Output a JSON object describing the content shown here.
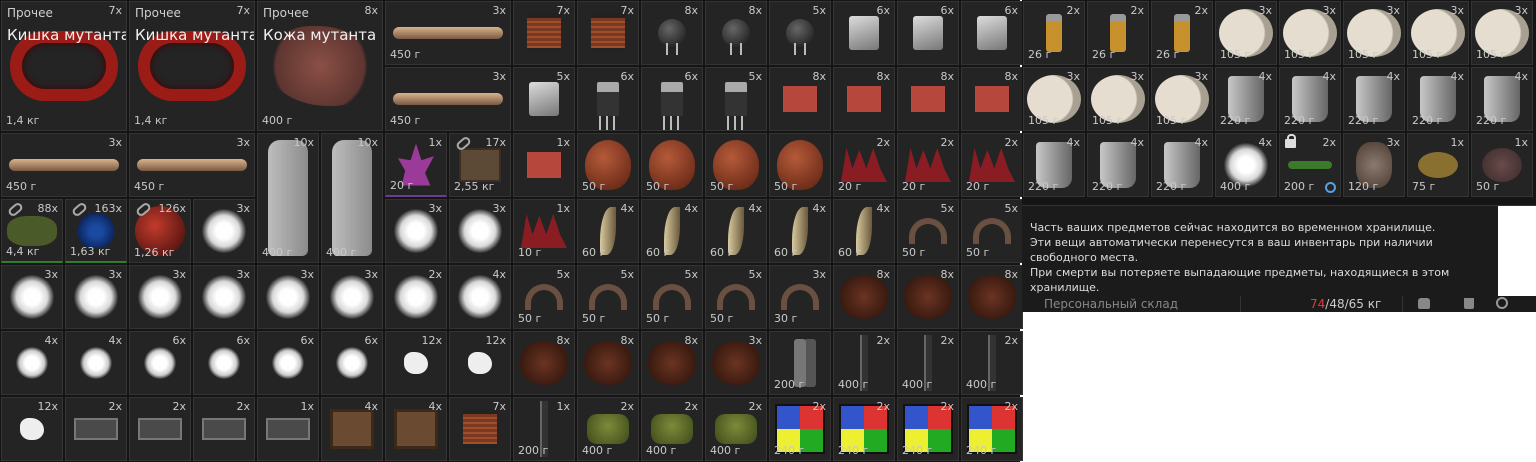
{
  "inventory": {
    "items": [
      {
        "cat": "Прочее",
        "name": "Кишка мутанта",
        "qty": "7x",
        "wt": "1,4 кг",
        "icon": "guts-icon"
      },
      {
        "cat": "Прочее",
        "name": "Кишка мутанта",
        "qty": "7x",
        "wt": "1,4 кг",
        "icon": "guts-icon"
      },
      {
        "cat": "Прочее",
        "name": "Кожа мутанта",
        "qty": "8x",
        "wt": "400 г",
        "icon": "skin-icon"
      },
      {
        "qty": "3x",
        "wt": "450 г",
        "icon": "bone-icon"
      },
      {
        "qty": "7x",
        "wt": "",
        "icon": "coil-icon"
      },
      {
        "qty": "7x",
        "wt": "",
        "icon": "coil-icon"
      },
      {
        "qty": "8x",
        "wt": "",
        "icon": "capacitor-icon"
      },
      {
        "qty": "8x",
        "wt": "",
        "icon": "capacitor-icon"
      },
      {
        "qty": "5x",
        "wt": "",
        "icon": "capacitor-icon"
      },
      {
        "qty": "6x",
        "wt": "",
        "icon": "crystal-icon"
      },
      {
        "qty": "6x",
        "wt": "",
        "icon": "crystal-icon"
      },
      {
        "qty": "6x",
        "wt": "",
        "icon": "crystal-icon"
      },
      {
        "qty": "3x",
        "wt": "450 г",
        "icon": "bone-icon"
      },
      {
        "qty": "5x",
        "wt": "",
        "icon": "crystal-icon"
      },
      {
        "qty": "6x",
        "wt": "",
        "icon": "transistor-icon"
      },
      {
        "qty": "6x",
        "wt": "",
        "icon": "transistor-icon"
      },
      {
        "qty": "5x",
        "wt": "",
        "icon": "transistor-icon"
      },
      {
        "qty": "8x",
        "wt": "",
        "icon": "circuit-board-icon"
      },
      {
        "qty": "8x",
        "wt": "",
        "icon": "circuit-board-icon"
      },
      {
        "qty": "8x",
        "wt": "",
        "icon": "circuit-board-icon"
      },
      {
        "qty": "8x",
        "wt": "",
        "icon": "circuit-board-icon"
      },
      {
        "qty": "3x",
        "wt": "450 г",
        "icon": "bone-icon"
      },
      {
        "qty": "3x",
        "wt": "450 г",
        "icon": "bone-icon"
      },
      {
        "qty": "10x",
        "wt": "400 г",
        "icon": "bottle-icon"
      },
      {
        "qty": "10x",
        "wt": "400 г",
        "icon": "bottle-icon"
      },
      {
        "qty": "1x",
        "wt": "20 г",
        "icon": "amethyst-icon"
      },
      {
        "qty": "17x",
        "wt": "2,55 кг",
        "icon": "box-icon",
        "link": true
      },
      {
        "qty": "1x",
        "wt": "",
        "icon": "circuit-board-icon"
      },
      {
        "qty": "",
        "wt": "50 г",
        "icon": "heart-icon"
      },
      {
        "qty": "",
        "wt": "50 г",
        "icon": "heart-icon"
      },
      {
        "qty": "",
        "wt": "50 г",
        "icon": "heart-icon"
      },
      {
        "qty": "",
        "wt": "50 г",
        "icon": "heart-icon"
      },
      {
        "qty": "2x",
        "wt": "20 г",
        "icon": "spikes-icon"
      },
      {
        "qty": "2x",
        "wt": "20 г",
        "icon": "spikes-icon"
      },
      {
        "qty": "2x",
        "wt": "20 г",
        "icon": "spikes-icon"
      },
      {
        "qty": "88x",
        "wt": "4,4 кг",
        "icon": "moss-icon",
        "link": true
      },
      {
        "qty": "163x",
        "wt": "1,63 кг",
        "icon": "blue-berries-icon",
        "link": true
      },
      {
        "qty": "126x",
        "wt": "1,26 кг",
        "icon": "red-orb-icon",
        "link": true
      },
      {
        "qty": "3x",
        "wt": "",
        "icon": "fluff-icon"
      },
      {
        "qty": "3x",
        "wt": "",
        "icon": "fluff-icon"
      },
      {
        "qty": "3x",
        "wt": "",
        "icon": "fluff-icon"
      },
      {
        "qty": "1x",
        "wt": "10 г",
        "icon": "spikes-icon"
      },
      {
        "qty": "4x",
        "wt": "60 г",
        "icon": "claw-icon"
      },
      {
        "qty": "4x",
        "wt": "60 г",
        "icon": "claw-icon"
      },
      {
        "qty": "4x",
        "wt": "60 г",
        "icon": "claw-icon"
      },
      {
        "qty": "4x",
        "wt": "60 г",
        "icon": "claw-icon"
      },
      {
        "qty": "4x",
        "wt": "60 г",
        "icon": "claw-icon"
      },
      {
        "qty": "5x",
        "wt": "50 г",
        "icon": "hoof-icon"
      },
      {
        "qty": "5x",
        "wt": "50 г",
        "icon": "hoof-icon"
      },
      {
        "qty": "3x",
        "wt": "",
        "icon": "fluff-icon"
      },
      {
        "qty": "3x",
        "wt": "",
        "icon": "fluff-icon"
      },
      {
        "qty": "3x",
        "wt": "",
        "icon": "fluff-icon"
      },
      {
        "qty": "3x",
        "wt": "",
        "icon": "fluff-icon"
      },
      {
        "qty": "3x",
        "wt": "",
        "icon": "fluff-icon"
      },
      {
        "qty": "3x",
        "wt": "",
        "icon": "fluff-icon"
      },
      {
        "qty": "2x",
        "wt": "",
        "icon": "fluff-icon"
      },
      {
        "qty": "4x",
        "wt": "",
        "icon": "fluff-icon"
      },
      {
        "qty": "5x",
        "wt": "50 г",
        "icon": "hoof-icon"
      },
      {
        "qty": "5x",
        "wt": "50 г",
        "icon": "hoof-icon"
      },
      {
        "qty": "5x",
        "wt": "50 г",
        "icon": "hoof-icon"
      },
      {
        "qty": "5x",
        "wt": "50 г",
        "icon": "hoof-icon"
      },
      {
        "qty": "3x",
        "wt": "30 г",
        "icon": "hoof-icon"
      },
      {
        "qty": "8x",
        "wt": "",
        "icon": "fur-icon"
      },
      {
        "qty": "8x",
        "wt": "",
        "icon": "fur-icon"
      },
      {
        "qty": "8x",
        "wt": "",
        "icon": "fur-icon"
      },
      {
        "qty": "4x",
        "wt": "",
        "icon": "fluff-small-icon"
      },
      {
        "qty": "4x",
        "wt": "",
        "icon": "fluff-small-icon"
      },
      {
        "qty": "6x",
        "wt": "",
        "icon": "fluff-small-icon"
      },
      {
        "qty": "6x",
        "wt": "",
        "icon": "fluff-small-icon"
      },
      {
        "qty": "6x",
        "wt": "",
        "icon": "fluff-small-icon"
      },
      {
        "qty": "6x",
        "wt": "",
        "icon": "fluff-small-icon"
      },
      {
        "qty": "12x",
        "wt": "",
        "icon": "rock-icon"
      },
      {
        "qty": "12x",
        "wt": "",
        "icon": "rock-icon"
      },
      {
        "qty": "8x",
        "wt": "",
        "icon": "fur-icon"
      },
      {
        "qty": "8x",
        "wt": "",
        "icon": "fur-icon"
      },
      {
        "qty": "8x",
        "wt": "",
        "icon": "fur-icon"
      },
      {
        "qty": "3x",
        "wt": "",
        "icon": "fur-icon"
      },
      {
        "qty": "",
        "wt": "200 г",
        "icon": "pliers-icon"
      },
      {
        "qty": "2x",
        "wt": "400 г",
        "icon": "knife-icon"
      },
      {
        "qty": "2x",
        "wt": "400 г",
        "icon": "knife-icon"
      },
      {
        "qty": "2x",
        "wt": "400 г",
        "icon": "knife-icon"
      },
      {
        "qty": "12x",
        "wt": "",
        "icon": "rock-icon"
      },
      {
        "qty": "2x",
        "wt": "",
        "icon": "solenoid-icon"
      },
      {
        "qty": "2x",
        "wt": "",
        "icon": "solenoid-icon"
      },
      {
        "qty": "2x",
        "wt": "",
        "icon": "solenoid-icon"
      },
      {
        "qty": "1x",
        "wt": "",
        "icon": "solenoid-icon"
      },
      {
        "qty": "4x",
        "wt": "",
        "icon": "transformer-icon"
      },
      {
        "qty": "4x",
        "wt": "",
        "icon": "transformer-icon"
      },
      {
        "qty": "7x",
        "wt": "",
        "icon": "coil-icon"
      },
      {
        "qty": "1x",
        "wt": "200 г",
        "icon": "knife-icon"
      },
      {
        "qty": "2x",
        "wt": "400 г",
        "icon": "mine-icon"
      },
      {
        "qty": "2x",
        "wt": "400 г",
        "icon": "mine-icon"
      },
      {
        "qty": "2x",
        "wt": "400 г",
        "icon": "mine-icon"
      },
      {
        "qty": "2x",
        "wt": "240 г",
        "icon": "rubik-cube-icon"
      },
      {
        "qty": "2x",
        "wt": "240 г",
        "icon": "rubik-cube-icon"
      },
      {
        "qty": "2x",
        "wt": "240 г",
        "icon": "rubik-cube-icon"
      },
      {
        "qty": "2x",
        "wt": "240 г",
        "icon": "rubik-cube-icon"
      }
    ]
  },
  "storage": {
    "items": [
      {
        "qty": "2x",
        "wt": "26 г",
        "icon": "lighter-icon"
      },
      {
        "qty": "2x",
        "wt": "26 г",
        "icon": "lighter-icon"
      },
      {
        "qty": "2x",
        "wt": "26 г",
        "icon": "lighter-icon"
      },
      {
        "qty": "3x",
        "wt": "105 г",
        "icon": "tape-roll-icon"
      },
      {
        "qty": "3x",
        "wt": "105 г",
        "icon": "tape-roll-icon"
      },
      {
        "qty": "3x",
        "wt": "105 г",
        "icon": "tape-roll-icon"
      },
      {
        "qty": "3x",
        "wt": "105 г",
        "icon": "tape-roll-icon"
      },
      {
        "qty": "3x",
        "wt": "105 г",
        "icon": "tape-roll-icon"
      },
      {
        "qty": "3x",
        "wt": "105 г",
        "icon": "tape-roll-icon"
      },
      {
        "qty": "3x",
        "wt": "105 г",
        "icon": "tape-roll-icon"
      },
      {
        "qty": "3x",
        "wt": "105 г",
        "icon": "tape-roll-icon"
      },
      {
        "qty": "4x",
        "wt": "220 г",
        "icon": "pot-icon"
      },
      {
        "qty": "4x",
        "wt": "220 г",
        "icon": "pot-icon"
      },
      {
        "qty": "4x",
        "wt": "220 г",
        "icon": "pot-icon"
      },
      {
        "qty": "4x",
        "wt": "220 г",
        "icon": "pot-icon"
      },
      {
        "qty": "4x",
        "wt": "220 г",
        "icon": "pot-icon"
      },
      {
        "qty": "4x",
        "wt": "220 г",
        "icon": "pot-icon"
      },
      {
        "qty": "4x",
        "wt": "220 г",
        "icon": "pot-icon"
      },
      {
        "qty": "4x",
        "wt": "220 г",
        "icon": "pot-icon"
      },
      {
        "qty": "4x",
        "wt": "400 г",
        "icon": "fluff-icon"
      },
      {
        "qty": "2x",
        "wt": "200 г",
        "icon": "key-icon",
        "lock": true,
        "clock": true
      },
      {
        "qty": "3x",
        "wt": "120 г",
        "icon": "critter-icon"
      },
      {
        "qty": "1x",
        "wt": "75 г",
        "icon": "nest-icon"
      },
      {
        "qty": "1x",
        "wt": "50 г",
        "icon": "rat-icon"
      }
    ]
  },
  "tooltip": {
    "text": "Часть ваших предметов сейчас находится во временном хранилище.\nЭти вещи автоматически перенесутся в ваш инвентарь при наличии свободного места.\nПри смерти вы потеряете выпадающие предметы, находящиеся в этом хранилище."
  },
  "stash": {
    "label": "Персональный склад",
    "weight_current": "74",
    "weight_rest": "/48/65 кг"
  },
  "colors": {
    "overweight": "#e03a3a",
    "panel": "#151515",
    "cell": "#242424"
  }
}
